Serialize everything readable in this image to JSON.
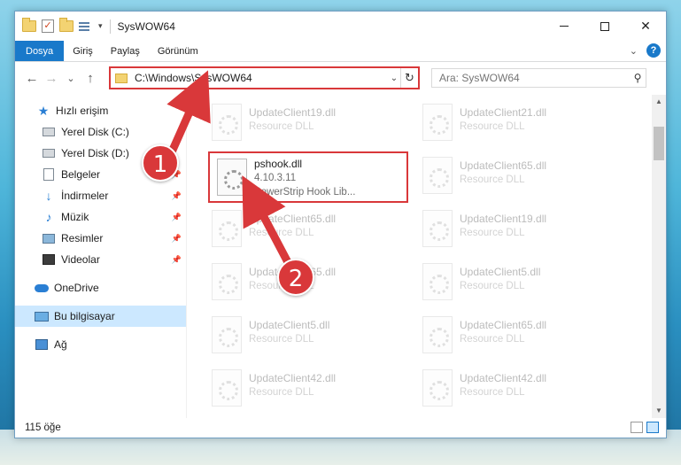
{
  "window": {
    "title": "SysWOW64"
  },
  "titlebar": {
    "minimize": "—",
    "maximize": "",
    "close": "✕"
  },
  "ribbon": {
    "tabs": [
      {
        "label": "Dosya",
        "active": true
      },
      {
        "label": "Giriş"
      },
      {
        "label": "Paylaş"
      },
      {
        "label": "Görünüm"
      }
    ],
    "help": "?"
  },
  "nav": {
    "back": "←",
    "forward": "→",
    "recent": "⌄",
    "up": "↑"
  },
  "address": {
    "path": "C:\\Windows\\SysWOW64",
    "refresh": "↻",
    "dropdown": "⌄"
  },
  "search": {
    "placeholder": "Ara: SysWOW64"
  },
  "navpane": {
    "items": [
      {
        "label": "Hızlı erişim",
        "icon": "star-icon"
      },
      {
        "label": "Yerel Disk (C:)",
        "icon": "drive-icon"
      },
      {
        "label": "Yerel Disk (D:)",
        "icon": "drive-icon"
      },
      {
        "label": "Belgeler",
        "icon": "documents-icon",
        "pinned": true
      },
      {
        "label": "İndirmeler",
        "icon": "downloads-icon",
        "pinned": true
      },
      {
        "label": "Müzik",
        "icon": "music-icon",
        "pinned": true
      },
      {
        "label": "Resimler",
        "icon": "pictures-icon",
        "pinned": true
      },
      {
        "label": "Videolar",
        "icon": "videos-icon",
        "pinned": true
      },
      {
        "label": "OneDrive",
        "icon": "onedrive-icon"
      },
      {
        "label": "Bu bilgisayar",
        "icon": "this-pc-icon",
        "selected": true
      },
      {
        "label": "Ağ",
        "icon": "network-icon"
      }
    ]
  },
  "files": {
    "left": [
      {
        "name": "UpdateClient19.dll",
        "sub": "Resource DLL"
      },
      {
        "name": "pshook.dll",
        "sub": "4.10.3.11",
        "sub2": "PowerStrip Hook Lib...",
        "highlighted": true
      },
      {
        "name": "UpdateClient65.dll",
        "sub": "Resource DLL"
      },
      {
        "name": "UpdateClient65.dll",
        "sub": "Resource DLL"
      },
      {
        "name": "UpdateClient5.dll",
        "sub": "Resource DLL"
      },
      {
        "name": "UpdateClient42.dll",
        "sub": "Resource DLL"
      }
    ],
    "right": [
      {
        "name": "UpdateClient21.dll",
        "sub": "Resource DLL"
      },
      {
        "name": "UpdateClient65.dll",
        "sub": "Resource DLL"
      },
      {
        "name": "UpdateClient19.dll",
        "sub": "Resource DLL"
      },
      {
        "name": "UpdateClient5.dll",
        "sub": "Resource DLL"
      },
      {
        "name": "UpdateClient65.dll",
        "sub": "Resource DLL"
      },
      {
        "name": "UpdateClient42.dll",
        "sub": "Resource DLL"
      }
    ]
  },
  "status": {
    "count": "115 öğe"
  },
  "annotations": {
    "step1": "1",
    "step2": "2",
    "color": "#d9383a"
  }
}
